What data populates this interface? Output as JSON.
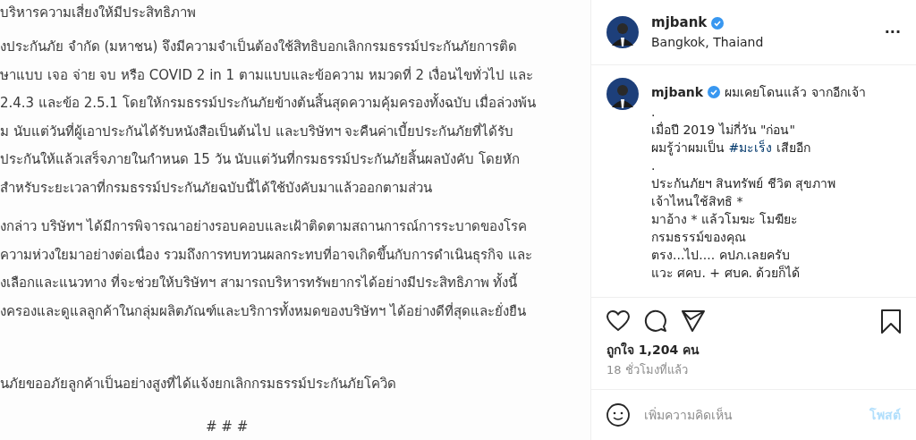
{
  "document": {
    "heading": "บริหารความเสี่ยงให้มีประสิทธิภาพ",
    "paragraphs": [
      [
        "งประกันภัย จำกัด (มหาชน) จึงมีความจำเป็นต้องใช้สิทธิบอกเลิกกรมธรรม์ประกันภัยการติด",
        "ษาแบบ เจอ จ่าย จบ หรือ COVID 2 in 1 ตามแบบและข้อความ หมวดที่ 2 เงื่อนไขทั่วไป และ",
        "2.4.3 และข้อ 2.5.1 โดยให้กรมธรรม์ประกันภัยข้างต้นสิ้นสุดความคุ้มครองทั้งฉบับ เมื่อล่วงพ้น",
        "ม นับแต่วันที่ผู้เอาประกันได้รับหนังสือเป็นต้นไป และบริษัทฯ จะคืนค่าเบี้ยประกันภัยที่ได้รับ",
        "ประกันให้แล้วเสร็จภายในกำหนด 15 วัน นับแต่วันที่กรมธรรม์ประกันภัยสิ้นผลบังคับ โดยหัก",
        "สำหรับระยะเวลาที่กรมธรรม์ประกันภัยฉบับนี้ได้ใช้บังคับมาแล้วออกตามส่วน"
      ],
      [
        "งกล่าว บริษัทฯ ได้มีการพิจารณาอย่างรอบคอบและเฝ้าติดตามสถานการณ์การระบาดของโรค",
        "ความห่วงใยมาอย่างต่อเนื่อง รวมถึงการทบทวนผลกระทบที่อาจเกิดขึ้นกับการดำเนินธุรกิจ และ",
        "งเลือกและแนวทาง ที่จะช่วยให้บริษัทฯ สามารถบริหารทรัพยากรได้อย่างมีประสิทธิภาพ ทั้งนี้",
        "งครองและดูแลลูกค้าในกลุ่มผลิตภัณฑ์และบริการทั้งหมดของบริษัทฯ ได้อย่างดีที่สุดและยั่งยืน"
      ],
      [
        "นภัยขออภัยลูกค้าเป็นอย่างสูงที่ได้แจ้งยกเลิกกรมธรรม์ประกันภัยโควิด"
      ]
    ],
    "end_mark": "# # #"
  },
  "post": {
    "username": "mjbank",
    "verified": true,
    "location": "Bangkok, Thaiand",
    "more": "...",
    "caption": {
      "username": "mjbank",
      "verified": true,
      "first_line": "ผมเคยโดนแล้ว จากอีกเจ้า",
      "lines": [
        {
          "parts": [
            {
              "kind": "text",
              "text": "."
            }
          ]
        },
        {
          "parts": [
            {
              "kind": "text",
              "text": "เมื่อปี 2019 ไม่กี่วัน \"ก่อน\""
            }
          ]
        },
        {
          "parts": [
            {
              "kind": "text",
              "text": "ผมรู้ว่าผมเป็น "
            },
            {
              "kind": "hashtag",
              "text": "#มะเร็ง"
            },
            {
              "kind": "text",
              "text": " เสียอีก"
            }
          ]
        },
        {
          "parts": [
            {
              "kind": "text",
              "text": "."
            }
          ]
        },
        {
          "parts": [
            {
              "kind": "text",
              "text": "ประกันภัยฯ สินทรัพย์ ชีวิต สุขภาพ"
            }
          ]
        },
        {
          "parts": [
            {
              "kind": "text",
              "text": "เจ้าไหนใช้สิทธิ *"
            }
          ]
        },
        {
          "parts": [
            {
              "kind": "text",
              "text": "มาอ้าง * แล้วโมฆะ โมฆียะ"
            }
          ]
        },
        {
          "parts": [
            {
              "kind": "text",
              "text": "กรมธรรม์ของคุณ"
            }
          ]
        },
        {
          "parts": [
            {
              "kind": "text",
              "text": "ตรง...ไป.... คปภ.เลยครับ"
            }
          ]
        },
        {
          "parts": [
            {
              "kind": "text",
              "text": "แวะ ศคบ. + ศบค. ด้วยก็ได้"
            }
          ]
        }
      ]
    },
    "liked": false,
    "saved": false,
    "likes": "ถูกใจ 1,204 คน",
    "time": "18 ชั่วโมงที่แล้ว",
    "comment": {
      "placeholder": "เพิ่มความคิดเห็น",
      "post_button": "โพสต์",
      "post_disabled": true
    }
  }
}
